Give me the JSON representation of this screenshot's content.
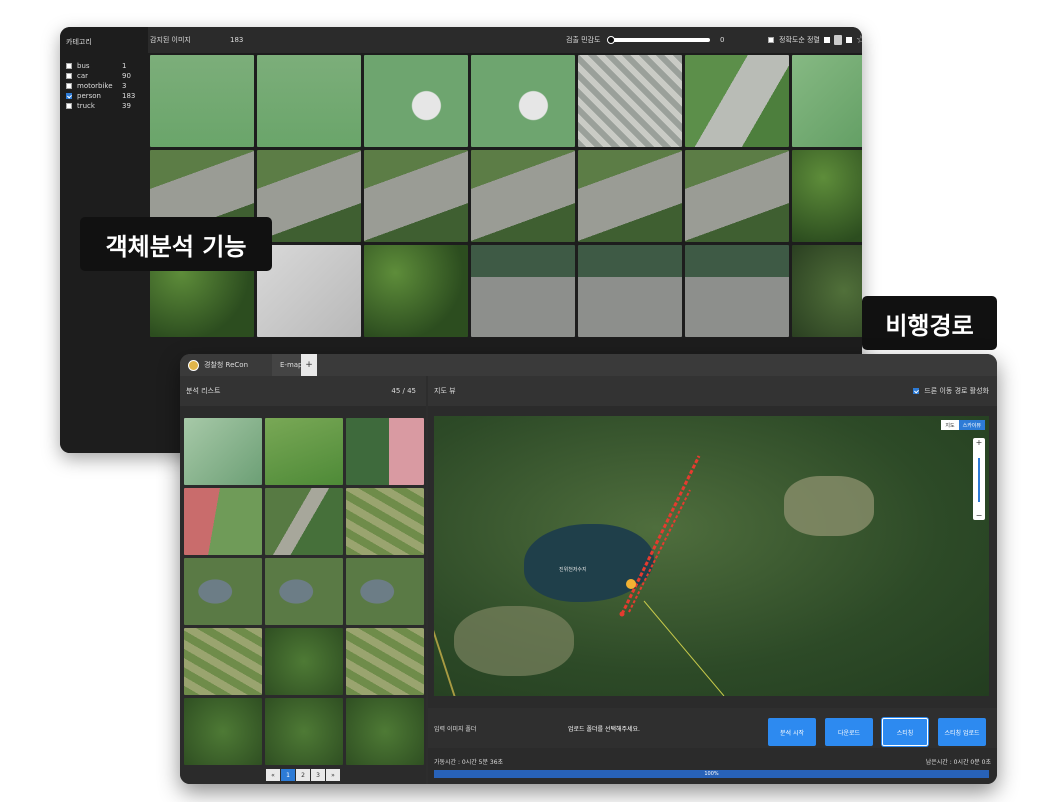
{
  "back_window": {
    "category_title": "카테고리",
    "categories": [
      {
        "name": "bus",
        "count": "1",
        "checked": false
      },
      {
        "name": "car",
        "count": "90",
        "checked": false
      },
      {
        "name": "motorbike",
        "count": "3",
        "checked": false
      },
      {
        "name": "person",
        "count": "183",
        "checked": true
      },
      {
        "name": "truck",
        "count": "39",
        "checked": false
      }
    ],
    "header": {
      "label": "감지된 이미지",
      "count": "183",
      "slider_label": "검출 민감도",
      "slider_value": "0",
      "sort_label": "정확도순 정렬"
    }
  },
  "labels": {
    "object_analysis": "객체분석 기능",
    "flight_path": "비행경로"
  },
  "front_window": {
    "tabs": {
      "first": "경찰청 ReCon",
      "second": "E-map",
      "plus": "+"
    },
    "left": {
      "title": "분석 리스트",
      "count": "45 / 45",
      "pages": [
        "«",
        "1",
        "2",
        "3",
        "»"
      ],
      "active_page": "1"
    },
    "right": {
      "title": "지도 뷰",
      "toggle_label": "드론 이동 경로 활성화",
      "map_types": [
        "지도",
        "스카이뷰"
      ],
      "map_place": "진위천저수지"
    },
    "controls": {
      "input_label": "입력 이미지 폴더",
      "message": "업로드 폴더를 선택해주세요.",
      "buttons": [
        "분석 시작",
        "다운로드",
        "스티칭",
        "스티칭 업로드"
      ]
    },
    "time": {
      "elapsed": "가동시간 : 0시간 5분 36초",
      "remaining": "남은시간 : 0시간 0분 0초"
    },
    "progress": {
      "value": 100,
      "label": "100%"
    }
  },
  "colors": {
    "accent": "#2d8af0",
    "route": "#e53b2f",
    "progress": "#2862b8"
  }
}
